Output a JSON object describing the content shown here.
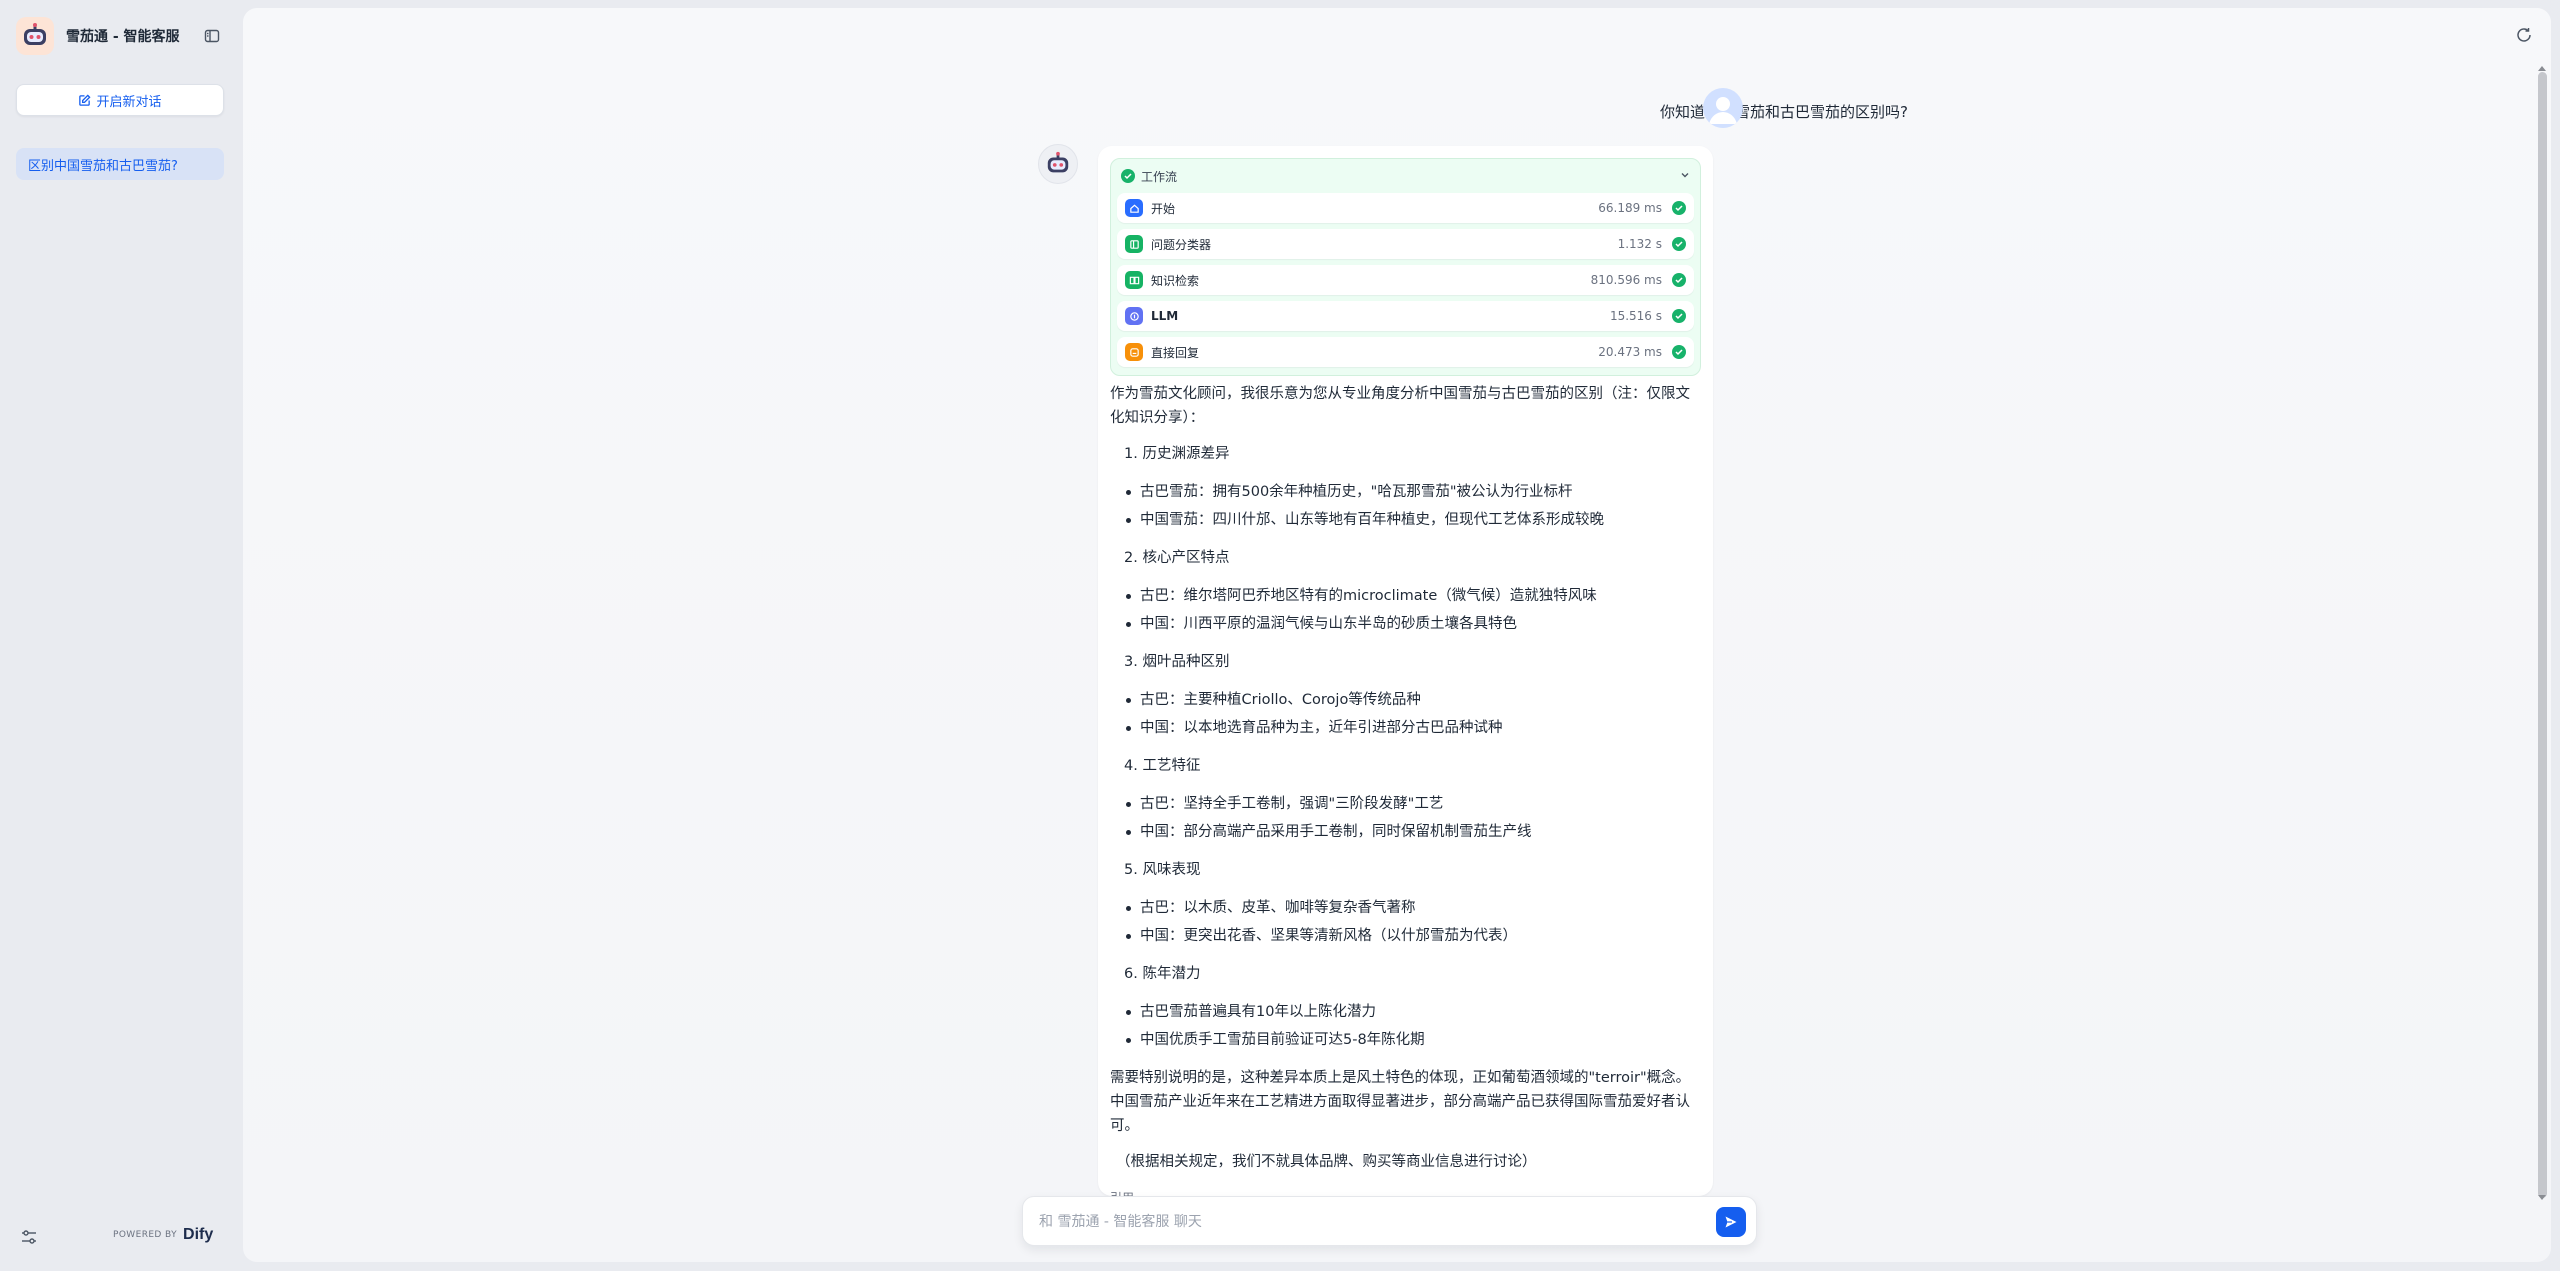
{
  "app": {
    "title": "雪茄通 - 智能客服",
    "new_chat_label": "开启新对话",
    "powered_by": "POWERED BY",
    "powered_brand": "Dify"
  },
  "sidebar": {
    "conversations": [
      {
        "label": "区别中国雪茄和古巴雪茄?",
        "active": true
      }
    ]
  },
  "chat": {
    "user_question": "你知道中国雪茄和古巴雪茄的区别吗?",
    "workflow": {
      "title": "工作流",
      "nodes": [
        {
          "title": "开始",
          "time": "66.189 ms",
          "icon": "home-icon",
          "color": "#296dff"
        },
        {
          "title": "问题分类器",
          "time": "1.132 s",
          "icon": "classifier-icon",
          "color": "#16b364"
        },
        {
          "title": "知识检索",
          "time": "810.596 ms",
          "icon": "book-icon",
          "color": "#16b364"
        },
        {
          "title": "LLM",
          "time": "15.516 s",
          "icon": "llm-icon",
          "color": "#6172f3"
        },
        {
          "title": "直接回复",
          "time": "20.473 ms",
          "icon": "reply-icon",
          "color": "#f79009"
        }
      ]
    },
    "answer": {
      "intro": "作为雪茄文化顾问，我很乐意为您从专业角度分析中国雪茄与古巴雪茄的区别（注：仅限文化知识分享）：",
      "sections": [
        {
          "heading": "1. 历史渊源差异",
          "bullets": [
            "古巴雪茄：拥有500余年种植历史，\"哈瓦那雪茄\"被公认为行业标杆",
            "中国雪茄：四川什邡、山东等地有百年种植史，但现代工艺体系形成较晚"
          ]
        },
        {
          "heading": "2. 核心产区特点",
          "bullets": [
            "古巴：维尔塔阿巴乔地区特有的microclimate（微气候）造就独特风味",
            "中国：川西平原的温润气候与山东半岛的砂质土壤各具特色"
          ]
        },
        {
          "heading": "3. 烟叶品种区别",
          "bullets": [
            "古巴：主要种植Criollo、Corojo等传统品种",
            "中国：以本地选育品种为主，近年引进部分古巴品种试种"
          ]
        },
        {
          "heading": "4. 工艺特征",
          "bullets": [
            "古巴：坚持全手工卷制，强调\"三阶段发酵\"工艺",
            "中国：部分高端产品采用手工卷制，同时保留机制雪茄生产线"
          ]
        },
        {
          "heading": "5. 风味表现",
          "bullets": [
            "古巴：以木质、皮革、咖啡等复杂香气著称",
            "中国：更突出花香、坚果等清新风格（以什邡雪茄为代表）"
          ]
        },
        {
          "heading": "6. 陈年潜力",
          "bullets": [
            "古巴雪茄普遍具有10年以上陈化潜力",
            "中国优质手工雪茄目前验证可达5-8年陈化期"
          ]
        }
      ],
      "conclusion": "需要特别说明的是，这种差异本质上是风土特色的体现，正如葡萄酒领域的\"terroir\"概念。中国雪茄产业近年来在工艺精进方面取得显著进步，部分高端产品已获得国际雪茄爱好者认可。",
      "notice": "（根据相关规定，我们不就具体品牌、购买等商业信息进行讨论）",
      "citation_label": "引用"
    },
    "input_placeholder": "和 雪茄通 - 智能客服 聊天",
    "colors": {
      "accent": "#155eef",
      "success": "#17b26a"
    }
  }
}
